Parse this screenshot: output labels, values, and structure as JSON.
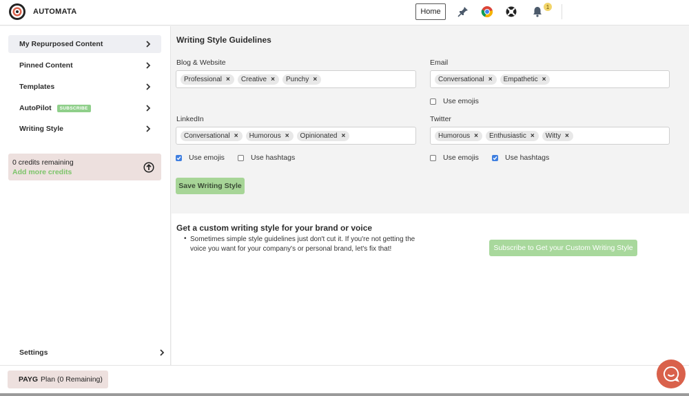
{
  "header": {
    "brand": "AUTOMATA",
    "home_label": "Home",
    "notification_count": "1",
    "icons": [
      "pin-icon",
      "chrome-icon",
      "lifebuoy-icon",
      "bell-icon"
    ]
  },
  "sidebar": {
    "items": [
      {
        "label": "My Repurposed Content"
      },
      {
        "label": "Pinned Content"
      },
      {
        "label": "Templates"
      },
      {
        "label": "AutoPilot",
        "badge": "SUBSCRIBE"
      },
      {
        "label": "Writing Style"
      }
    ],
    "credits": {
      "remaining": "0 credits remaining",
      "add": "Add more credits"
    },
    "settings_label": "Settings"
  },
  "footer": {
    "plan_bold": "PAYG",
    "plan_rest": "Plan (0 Remaining)"
  },
  "main": {
    "title": "Writing Style Guidelines",
    "sections": {
      "blog": {
        "label": "Blog & Website",
        "tags": [
          "Professional",
          "Creative",
          "Punchy"
        ]
      },
      "email": {
        "label": "Email",
        "tags": [
          "Conversational",
          "Empathetic"
        ],
        "use_emojis": {
          "label": "Use emojis",
          "checked": false
        }
      },
      "linkedin": {
        "label": "LinkedIn",
        "tags": [
          "Conversational",
          "Humorous",
          "Opinionated"
        ],
        "use_emojis": {
          "label": "Use emojis",
          "checked": true
        },
        "use_hashtags": {
          "label": "Use hashtags",
          "checked": false
        }
      },
      "twitter": {
        "label": "Twitter",
        "tags": [
          "Humorous",
          "Enthusiastic",
          "Witty"
        ],
        "use_emojis": {
          "label": "Use emojis",
          "checked": false
        },
        "use_hashtags": {
          "label": "Use hashtags",
          "checked": true
        }
      }
    },
    "save_label": "Save Writing Style",
    "tag_remove_glyph": "×"
  },
  "custom": {
    "title": "Get a custom writing style for your brand or voice",
    "bullet": "•",
    "text": "Sometimes simple style guidelines just don't cut it. If you're not getting the voice you want for your company's or personal brand, let's fix that!",
    "button_label": "Subscribe to Get your Custom Writing Style"
  },
  "colors": {
    "accent_green": "#a7d597",
    "credits_bg": "#ede0de",
    "chat_button": "#d9614b",
    "checkbox_on": "#3f7fe0"
  }
}
